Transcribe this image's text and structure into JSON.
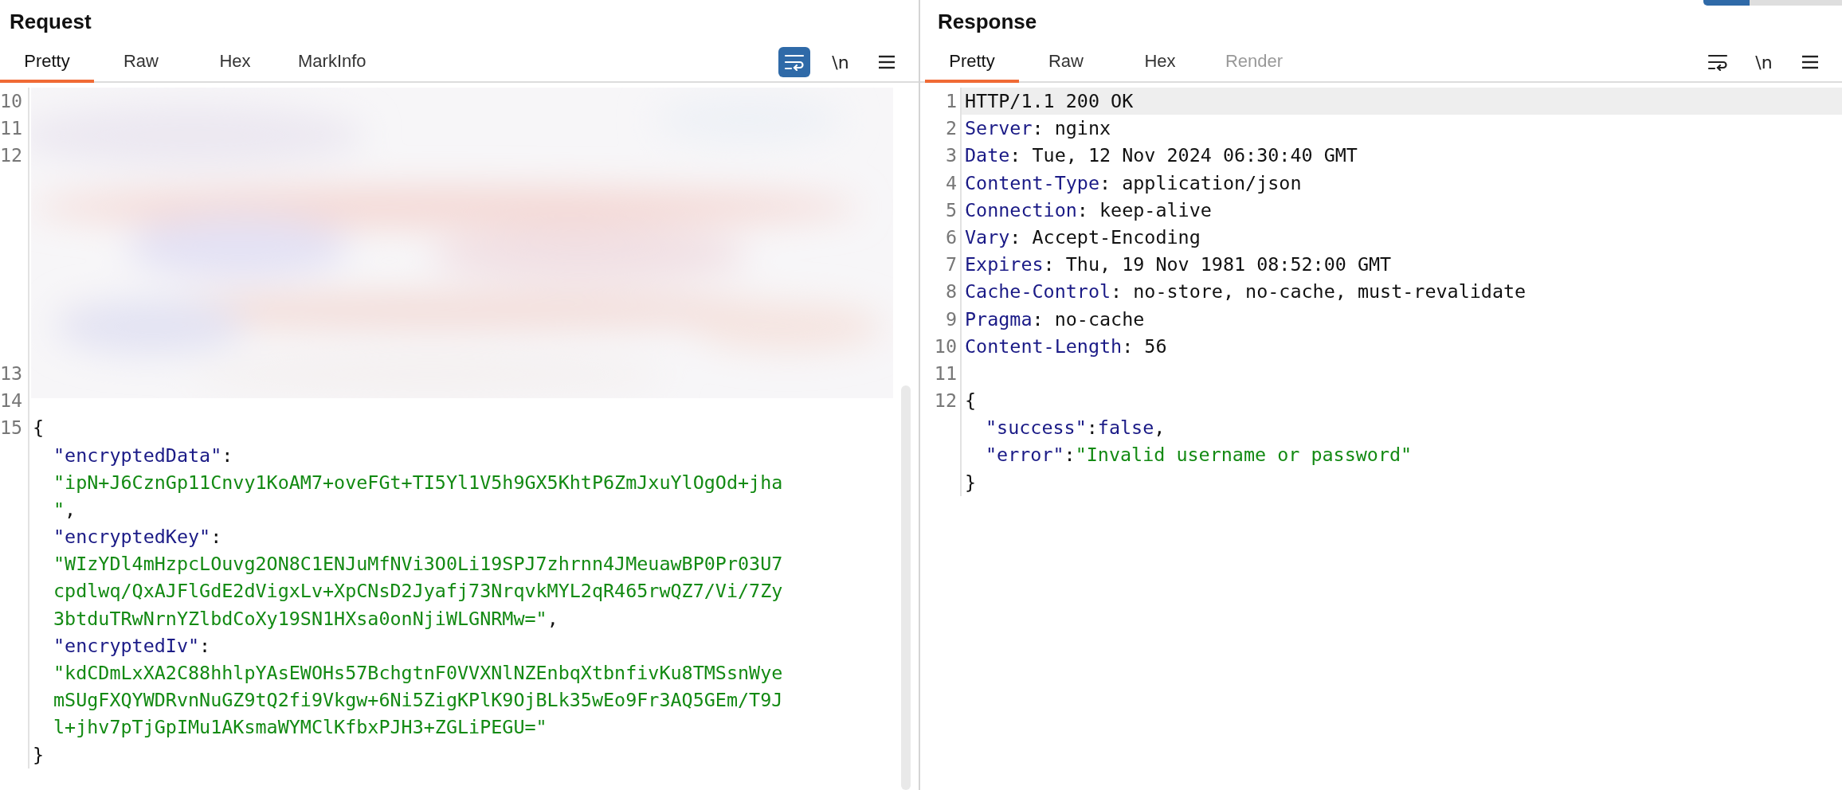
{
  "view_switch": {
    "segments": [
      {
        "selected": true
      },
      {
        "selected": false
      },
      {
        "selected": false
      }
    ]
  },
  "request": {
    "title": "Request",
    "tabs": [
      {
        "label": "Pretty",
        "selected": true,
        "disabled": false
      },
      {
        "label": "Raw",
        "selected": false,
        "disabled": false
      },
      {
        "label": "Hex",
        "selected": false,
        "disabled": false
      },
      {
        "label": "MarkInfo",
        "selected": false,
        "disabled": false
      }
    ],
    "wrap_on": true,
    "newline_label": "\\n",
    "redacted_area": {
      "kind": "picture",
      "lines": [
        {
          "number": "10"
        },
        {
          "number": "11"
        },
        {
          "number": "12"
        }
      ]
    },
    "lines": [
      {
        "number": "13"
      },
      {
        "number": "14"
      },
      {
        "number": "15",
        "rows": [
          {
            "indent": false,
            "tokens": [
              {
                "kind": "plain",
                "text": "{"
              }
            ]
          },
          {
            "indent": true,
            "tokens": [
              {
                "kind": "key",
                "text": "\"encryptedData\""
              },
              {
                "kind": "plain",
                "text": ":"
              }
            ]
          },
          {
            "indent": true,
            "tokens": [
              {
                "kind": "string",
                "text": "\"ipN+J6CznGp11Cnvy1KoAM7+oveFGt+TI5Yl1V5h9GX5KhtP6ZmJxuYlOgOd+jha"
              }
            ]
          },
          {
            "indent": true,
            "tokens": [
              {
                "kind": "string",
                "text": "\""
              },
              {
                "kind": "plain",
                "text": ","
              }
            ]
          },
          {
            "indent": true,
            "tokens": [
              {
                "kind": "key",
                "text": "\"encryptedKey\""
              },
              {
                "kind": "plain",
                "text": ":"
              }
            ]
          },
          {
            "indent": true,
            "tokens": [
              {
                "kind": "string",
                "text": "\"WIzYDl4mHzpcLOuvg2ON8C1ENJuMfNVi3O0Li19SPJ7zhrnn4JMeuawBP0Pr03U7"
              }
            ]
          },
          {
            "indent": true,
            "tokens": [
              {
                "kind": "string",
                "text": "cpdlwq/QxAJFlGdE2dVigxLv+XpCNsD2Jyafj73NrqvkMYL2qR465rwQZ7/Vi/7Zy"
              }
            ]
          },
          {
            "indent": true,
            "tokens": [
              {
                "kind": "string",
                "text": "3btduTRwNrnYZlbdCoXy19SN1HXsa0onNjiWLGNRMw=\""
              },
              {
                "kind": "plain",
                "text": ","
              }
            ]
          },
          {
            "indent": true,
            "tokens": [
              {
                "kind": "key",
                "text": "\"encryptedIv\""
              },
              {
                "kind": "plain",
                "text": ":"
              }
            ]
          },
          {
            "indent": true,
            "tokens": [
              {
                "kind": "string",
                "text": "\"kdCDmLxXA2C88hhlpYAsEWOHs57BchgtnF0VVXNlNZEnbqXtbnfivKu8TMSsnWye"
              }
            ]
          },
          {
            "indent": true,
            "tokens": [
              {
                "kind": "string",
                "text": "mSUgFXQYWDRvnNuGZ9tQ2fi9Vkgw+6Ni5ZigKPlK9OjBLk35wEo9Fr3AQ5GEm/T9J"
              }
            ]
          },
          {
            "indent": true,
            "tokens": [
              {
                "kind": "string",
                "text": "l+jhv7pTjGpIMu1AKsmaWYMClKfbxPJH3+ZGLiPEGU=\""
              }
            ]
          },
          {
            "indent": false,
            "tokens": [
              {
                "kind": "plain",
                "text": "}"
              }
            ]
          }
        ]
      }
    ]
  },
  "response": {
    "title": "Response",
    "tabs": [
      {
        "label": "Pretty",
        "selected": true,
        "disabled": false
      },
      {
        "label": "Raw",
        "selected": false,
        "disabled": false
      },
      {
        "label": "Hex",
        "selected": false,
        "disabled": false
      },
      {
        "label": "Render",
        "selected": false,
        "disabled": true
      }
    ],
    "wrap_on": false,
    "newline_label": "\\n",
    "lines": [
      {
        "number": "1",
        "current": true,
        "rows": [
          {
            "indent": false,
            "tokens": [
              {
                "kind": "plain",
                "text": "HTTP/1.1 200 OK"
              }
            ]
          }
        ]
      },
      {
        "number": "2",
        "current": false,
        "rows": [
          {
            "indent": false,
            "tokens": [
              {
                "kind": "key",
                "text": "Server"
              },
              {
                "kind": "plain",
                "text": ": nginx"
              }
            ]
          }
        ]
      },
      {
        "number": "3",
        "current": false,
        "rows": [
          {
            "indent": false,
            "tokens": [
              {
                "kind": "key",
                "text": "Date"
              },
              {
                "kind": "plain",
                "text": ": Tue, 12 Nov 2024 06:30:40 GMT"
              }
            ]
          }
        ]
      },
      {
        "number": "4",
        "current": false,
        "rows": [
          {
            "indent": false,
            "tokens": [
              {
                "kind": "key",
                "text": "Content-Type"
              },
              {
                "kind": "plain",
                "text": ": application/json"
              }
            ]
          }
        ]
      },
      {
        "number": "5",
        "current": false,
        "rows": [
          {
            "indent": false,
            "tokens": [
              {
                "kind": "key",
                "text": "Connection"
              },
              {
                "kind": "plain",
                "text": ": keep-alive"
              }
            ]
          }
        ]
      },
      {
        "number": "6",
        "current": false,
        "rows": [
          {
            "indent": false,
            "tokens": [
              {
                "kind": "key",
                "text": "Vary"
              },
              {
                "kind": "plain",
                "text": ": Accept-Encoding"
              }
            ]
          }
        ]
      },
      {
        "number": "7",
        "current": false,
        "rows": [
          {
            "indent": false,
            "tokens": [
              {
                "kind": "key",
                "text": "Expires"
              },
              {
                "kind": "plain",
                "text": ": Thu, 19 Nov 1981 08:52:00 GMT"
              }
            ]
          }
        ]
      },
      {
        "number": "8",
        "current": false,
        "rows": [
          {
            "indent": false,
            "tokens": [
              {
                "kind": "key",
                "text": "Cache-Control"
              },
              {
                "kind": "plain",
                "text": ": no-store, no-cache, must-revalidate"
              }
            ]
          }
        ]
      },
      {
        "number": "9",
        "current": false,
        "rows": [
          {
            "indent": false,
            "tokens": [
              {
                "kind": "key",
                "text": "Pragma"
              },
              {
                "kind": "plain",
                "text": ": no-cache"
              }
            ]
          }
        ]
      },
      {
        "number": "10",
        "current": false,
        "rows": [
          {
            "indent": false,
            "tokens": [
              {
                "kind": "key",
                "text": "Content-Length"
              },
              {
                "kind": "plain",
                "text": ": 56"
              }
            ]
          }
        ]
      },
      {
        "number": "11",
        "current": false
      },
      {
        "number": "12",
        "current": false,
        "rows": [
          {
            "indent": false,
            "tokens": [
              {
                "kind": "plain",
                "text": "{"
              }
            ]
          },
          {
            "indent": true,
            "tokens": [
              {
                "kind": "key",
                "text": "\"success\""
              },
              {
                "kind": "plain",
                "text": ":"
              },
              {
                "kind": "key",
                "text": "false"
              },
              {
                "kind": "plain",
                "text": ","
              }
            ]
          },
          {
            "indent": true,
            "tokens": [
              {
                "kind": "key",
                "text": "\"error\""
              },
              {
                "kind": "plain",
                "text": ":"
              },
              {
                "kind": "string",
                "text": "\"Invalid username or password\""
              }
            ]
          },
          {
            "indent": false,
            "tokens": [
              {
                "kind": "plain",
                "text": "}"
              }
            ]
          }
        ]
      }
    ]
  }
}
